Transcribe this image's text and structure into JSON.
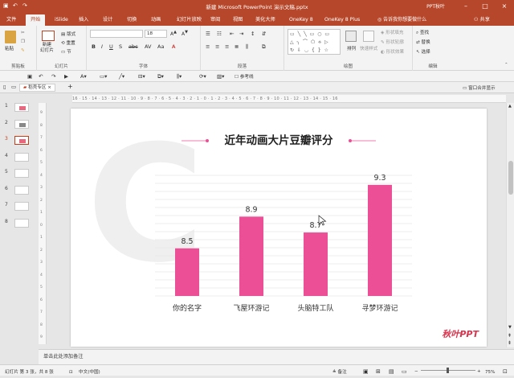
{
  "window": {
    "title": "新建 Microsoft PowerPoint 演示文稿.pptx",
    "account": "PPT秋叶"
  },
  "tabs": [
    {
      "label": "文件"
    },
    {
      "label": "开始"
    },
    {
      "label": "iSlide"
    },
    {
      "label": "插入"
    },
    {
      "label": "设计"
    },
    {
      "label": "切换"
    },
    {
      "label": "动画"
    },
    {
      "label": "幻灯片放映"
    },
    {
      "label": "审阅"
    },
    {
      "label": "视图"
    },
    {
      "label": "美化大师"
    },
    {
      "label": "OneKey 8"
    },
    {
      "label": "OneKey 8 Plus"
    }
  ],
  "tell_me": "告诉我你想要做什么",
  "share": "共享",
  "ribbon": {
    "clipboard": {
      "label": "剪贴板",
      "paste": "粘贴"
    },
    "slides": {
      "label": "幻灯片",
      "new_slide": "新建\n幻灯片",
      "layout": "版式",
      "reset": "重置",
      "section": "节"
    },
    "font": {
      "label": "字体",
      "font_size": "18"
    },
    "paragraph": {
      "label": "段落"
    },
    "drawing": {
      "label": "绘图",
      "arrange": "排列",
      "quick_styles": "快速样式",
      "shape_fill": "形状填充",
      "shape_outline": "形状轮廓",
      "shape_effects": "形状效果"
    },
    "editing": {
      "label": "编辑",
      "find": "查找",
      "replace": "替换",
      "select": "选择"
    }
  },
  "qat": {
    "guides": "参考线"
  },
  "doc_tab": {
    "label": "稻壳专区",
    "merge": "窗口合并显示"
  },
  "thumbnails": [
    {
      "num": "1"
    },
    {
      "num": "2"
    },
    {
      "num": "3"
    },
    {
      "num": "4"
    },
    {
      "num": "5"
    },
    {
      "num": "6"
    },
    {
      "num": "7"
    },
    {
      "num": "8"
    }
  ],
  "ruler_text": "16 · 15 · 14 · 13 · 12 · 11 · 10 · 9 · 8 · 7 · 6 · 5 · 4 · 3 · 2 · 1 · 0 · 1 · 2 · 3 · 4 · 5 · 6 · 7 · 8 · 9 · 10 · 11 · 12 · 13 · 14 · 15 · 16",
  "ruler_v": [
    "9",
    "8",
    "7",
    "6",
    "5",
    "4",
    "3",
    "2",
    "1",
    "0",
    "1",
    "2",
    "3",
    "4",
    "5",
    "6",
    "7",
    "8",
    "9"
  ],
  "chart_data": {
    "type": "bar",
    "title": "近年动画大片豆瓣评分",
    "categories": [
      "你的名字",
      "飞屋环游记",
      "头脑特工队",
      "寻梦环游记"
    ],
    "values": [
      8.5,
      8.9,
      8.7,
      9.3
    ],
    "value_labels": [
      "8.5",
      "8.9",
      "8.7",
      "9.3"
    ],
    "ylim": [
      7.9,
      9.4
    ],
    "bar_color": "#ec4f95",
    "grid": true
  },
  "watermark": "秋叶PPT",
  "notes_placeholder": "单击此处添加备注",
  "status": {
    "slide": "幻灯片 第 3 张，共 8 张",
    "language": "中文(中国)",
    "notes": "备注",
    "zoom": "75%"
  },
  "colors": {
    "accent": "#b7472a",
    "bar": "#ec4f95"
  }
}
